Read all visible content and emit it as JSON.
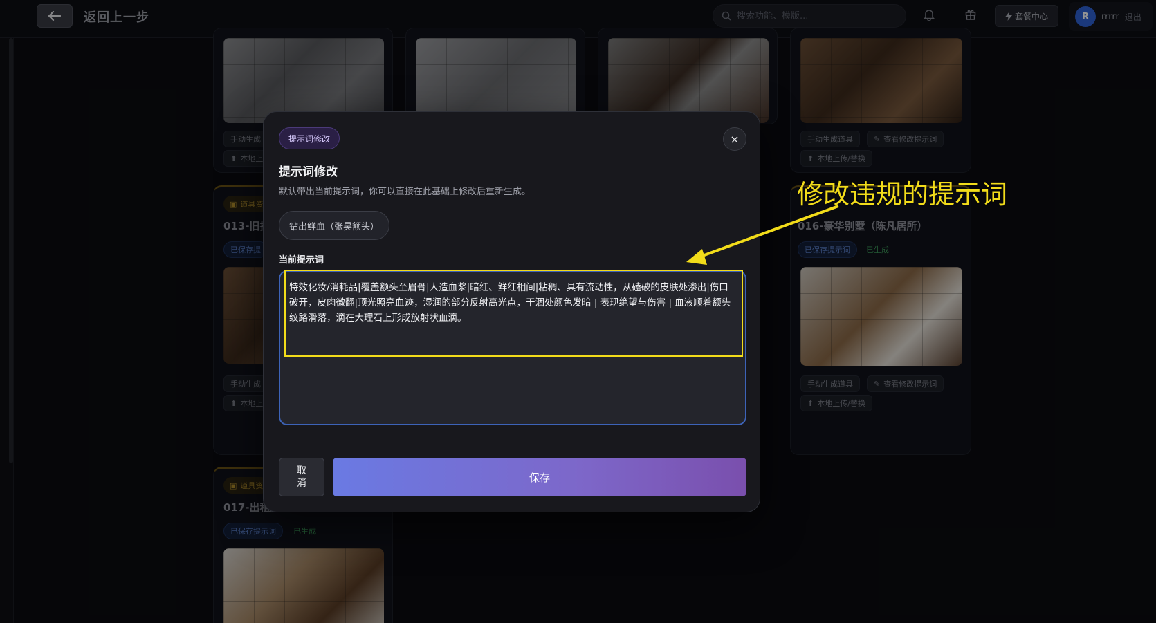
{
  "header": {
    "back_label": "返回上一步",
    "search_placeholder": "搜索功能、模版...",
    "plan_label": "套餐中心",
    "avatar_initial": "R",
    "username": "rrrrr",
    "logout": "退出"
  },
  "cards": {
    "manual_generate": "手动生成道具",
    "manual_generate_short": "手动生成",
    "view_prompt": "查看修改提示词",
    "upload_replace": "本地上传/替换",
    "upload_short": "本地上",
    "prop_tag": "道具资",
    "saved_prompt": "已保存提示词",
    "saved_short": "已保存提",
    "generated": "已生成",
    "card_013": "013-旧扳",
    "card_016": "016-豪华别墅（陈凡居所）",
    "card_017": "017-出租屋"
  },
  "modal": {
    "tag": "提示词修改",
    "title": "提示词修改",
    "description": "默认带出当前提示词，你可以直接在此基础上修改后重新生成。",
    "preset_chip": "钻出鲜血（张昊额头）",
    "field_label": "当前提示词",
    "prompt_value": "特效化妆/消耗品|覆盖额头至眉骨|人造血浆|暗红、鲜红相间|粘稠、具有流动性，从磕破的皮肤处渗出|伤口破开，皮肉微翻|顶光照亮血迹，湿润的部分反射高光点，干涸处颜色发暗 | 表现绝望与伤害 | 血液顺着额头纹路滑落，滴在大理石上形成放射状血滴。",
    "cancel": "取消",
    "save": "保存",
    "close": "×"
  },
  "annotation": {
    "text": "修改违规的提示词",
    "color": "#f2dc1a"
  }
}
